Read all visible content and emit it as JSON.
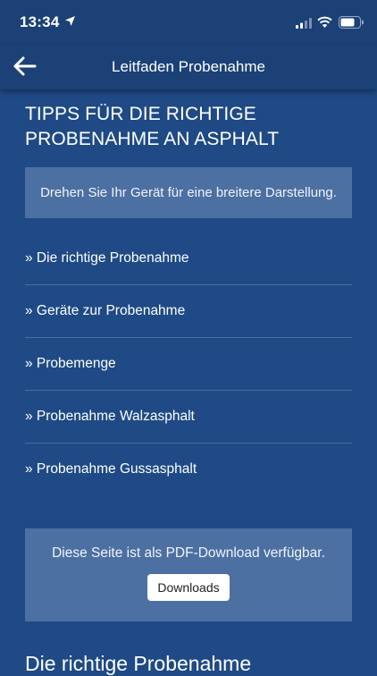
{
  "status": {
    "time": "13:34"
  },
  "icons": {
    "location": "location-arrow-icon",
    "signal": "cellular-signal-icon",
    "wifi": "wifi-icon",
    "battery": "battery-icon",
    "back": "back-arrow-icon"
  },
  "nav": {
    "title": "Leitfaden Probenahme"
  },
  "main": {
    "heading": "TIPPS FÜR DIE RICHTIGE PROBENAHME AN ASPHALT",
    "rotate_notice": "Drehen Sie Ihr Gerät für eine breitere Darstellung.",
    "links": [
      "» Die richtige Probenahme",
      "» Geräte zur Probenahme",
      "» Probemenge",
      "» Probenahme Walzasphalt",
      "» Probenahme Gussasphalt"
    ],
    "download_text": "Diese Seite ist als PDF-Download verfügbar.",
    "download_button": "Downloads",
    "section_heading": "Die richtige Probenahme"
  },
  "colors": {
    "background": "#1f4a86",
    "bar": "#1b4177",
    "box": "#4d70a3"
  }
}
